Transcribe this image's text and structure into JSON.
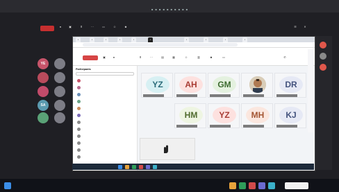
{
  "outer_window": {
    "title": "",
    "record_label": "",
    "status_right": ""
  },
  "meeting": {
    "group_title": "",
    "leave_label": "",
    "participants_header": "Participants",
    "search_placeholder": ""
  },
  "participants": [
    {
      "initials": "YE",
      "color": "#c7546a"
    },
    {
      "initials": "BR",
      "color": "#b76a8c"
    },
    {
      "initials": "KR",
      "color": "#6a8fb7"
    },
    {
      "initials": "SA",
      "color": "#6aa387"
    },
    {
      "initials": "HA",
      "color": "#c98b5a"
    },
    {
      "initials": "MI",
      "color": "#7a6ab7"
    }
  ],
  "left_avatars": [
    {
      "initials": "YE",
      "color": "#c7546a"
    },
    {
      "initials": "",
      "color": "#7d7d86"
    },
    {
      "initials": "",
      "color": "#b94b5c"
    },
    {
      "initials": "",
      "color": "#7d7d86"
    },
    {
      "initials": "",
      "color": "#c24b6a"
    },
    {
      "initials": "",
      "color": "#7d7d86"
    },
    {
      "initials": "SA",
      "color": "#5b9bb0"
    },
    {
      "initials": "",
      "color": "#7d7d86"
    },
    {
      "initials": "",
      "color": "#5aa277"
    },
    {
      "initials": "",
      "color": "#7d7d86"
    }
  ],
  "tiles": [
    {
      "initials": "YZ",
      "bg": "#d7f0f3",
      "fg": "#2a6b79"
    },
    {
      "initials": "AH",
      "bg": "#fde1df",
      "fg": "#a83b33"
    },
    {
      "initials": "GM",
      "bg": "#e4f1df",
      "fg": "#3d6b30"
    },
    {
      "initials": "",
      "bg": "#e8e1d9",
      "fg": "#000000",
      "photo": true
    },
    {
      "initials": "DR",
      "bg": "#e6e9f5",
      "fg": "#44537e"
    },
    {
      "initials": "HM",
      "bg": "#eef5e2",
      "fg": "#506b2e"
    },
    {
      "initials": "YZ",
      "bg": "#fde1df",
      "fg": "#a83b33"
    },
    {
      "initials": "MH",
      "bg": "#fbe7df",
      "fg": "#a35533"
    },
    {
      "initials": "KJ",
      "bg": "#e6e9f5",
      "fg": "#44537e"
    }
  ],
  "taskbar": {
    "time": "",
    "date": ""
  }
}
